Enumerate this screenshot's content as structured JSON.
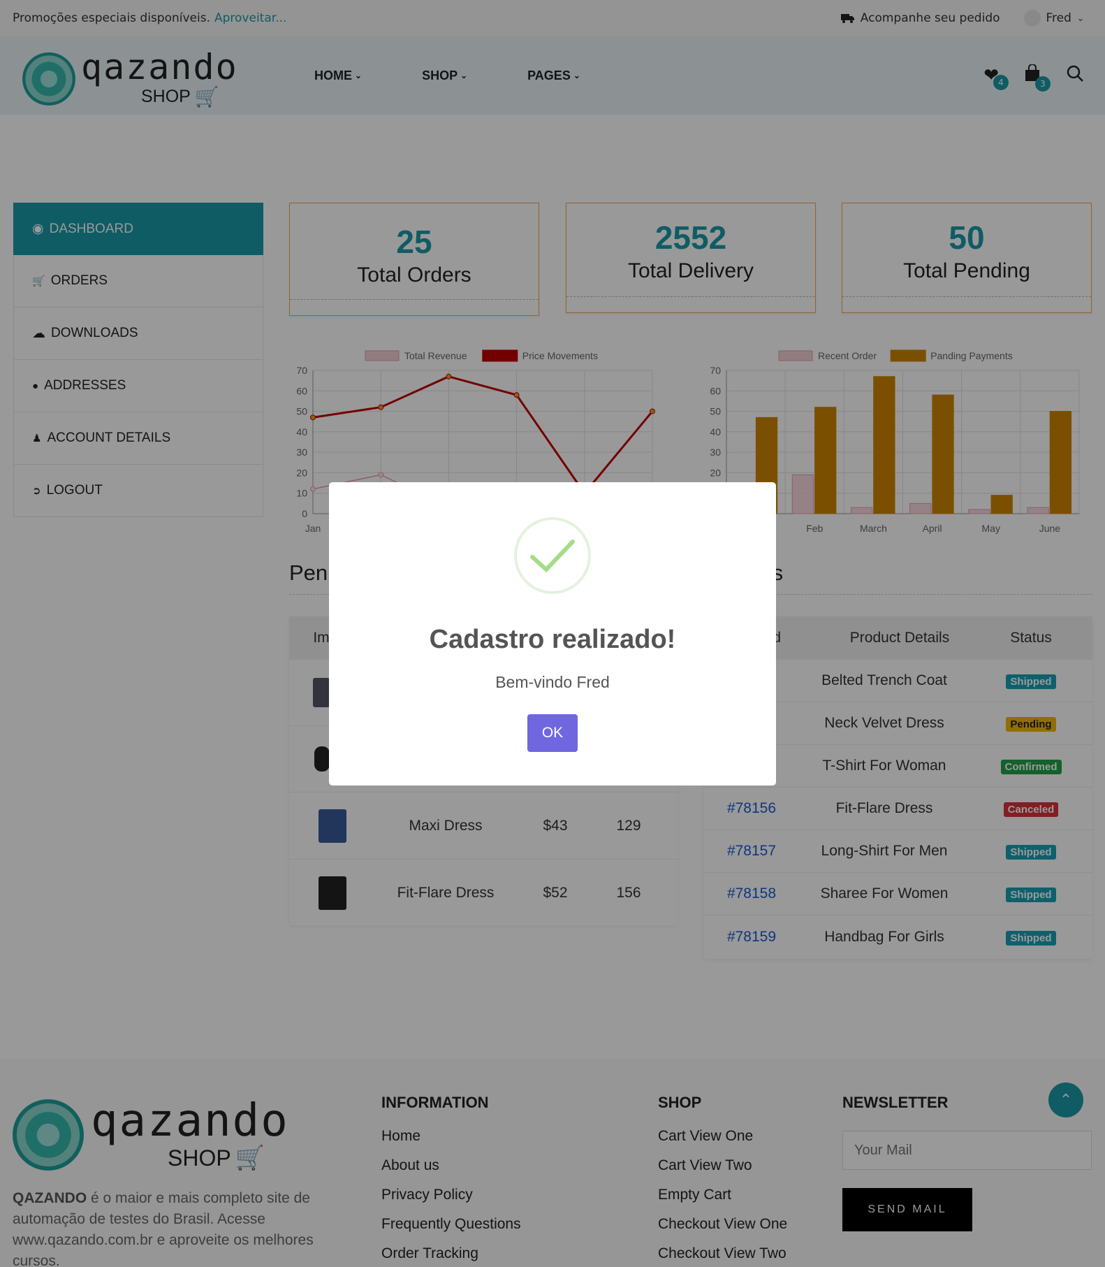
{
  "topbar": {
    "promo_text": "Promoções especiais disponíveis.",
    "promo_link": "Aproveitar...",
    "track_label": "Acompanhe seu pedido",
    "user_name": "Fred"
  },
  "header": {
    "logo_word": "qazando",
    "logo_shop": "SHOP",
    "nav": [
      {
        "label": "HOME"
      },
      {
        "label": "SHOP"
      },
      {
        "label": "PAGES"
      }
    ],
    "wishlist_count": "4",
    "cart_count": "3"
  },
  "sidebar": {
    "items": [
      {
        "label": "DASHBOARD",
        "icon": "dashboard-icon"
      },
      {
        "label": "ORDERS",
        "icon": "cart-icon"
      },
      {
        "label": "DOWNLOADS",
        "icon": "cloud-download-icon"
      },
      {
        "label": "ADDRESSES",
        "icon": "map-marker-icon"
      },
      {
        "label": "ACCOUNT DETAILS",
        "icon": "user-icon"
      },
      {
        "label": "LOGOUT",
        "icon": "logout-icon"
      }
    ]
  },
  "stats": [
    {
      "value": "25",
      "label": "Total Orders"
    },
    {
      "value": "2552",
      "label": "Total Delivery"
    },
    {
      "value": "50",
      "label": "Total Pending"
    }
  ],
  "chart_data": [
    {
      "type": "line",
      "categories": [
        "Jan",
        "Feb",
        "March",
        "April",
        "May",
        "June"
      ],
      "series": [
        {
          "name": "Total Revenue",
          "values": [
            12,
            19,
            3,
            5,
            2,
            3
          ],
          "color": "#e8a0ad"
        },
        {
          "name": "Price Movements",
          "values": [
            47,
            52,
            67,
            58,
            10,
            50
          ],
          "color": "#c00000"
        }
      ],
      "ylim": [
        0,
        70
      ],
      "yticks": [
        "70",
        "60",
        "50",
        "40",
        "30",
        "20",
        "10",
        "0"
      ],
      "grid": true,
      "legend": "top"
    },
    {
      "type": "bar",
      "categories": [
        "Jan",
        "Feb",
        "March",
        "April",
        "May",
        "June"
      ],
      "series": [
        {
          "name": "Recent Order",
          "values": [
            12,
            19,
            3,
            5,
            2,
            3
          ],
          "color": "#f6c9d2"
        },
        {
          "name": "Panding Payments",
          "values": [
            47,
            52,
            67,
            58,
            9,
            50
          ],
          "color": "#cc8500"
        }
      ],
      "ylim": [
        0,
        70
      ],
      "yticks": [
        "70",
        "60",
        "50",
        "40",
        "30",
        "20"
      ],
      "grid": true,
      "legend": "top"
    }
  ],
  "pending_section": {
    "title": "Pen",
    "head_image": "Im",
    "rows": [
      {
        "product": "Maxi Dress",
        "price": "$43",
        "qty": "129",
        "thumb": "#3a5a9a"
      },
      {
        "product": "Fit-Flare Dress",
        "price": "$52",
        "qty": "156",
        "thumb": "#222"
      }
    ]
  },
  "orders_section": {
    "title": "ers",
    "head_id": "d",
    "head_details": "Product Details",
    "head_status": "Status",
    "rows": [
      {
        "id": "",
        "product": "Belted Trench Coat",
        "status": "Shipped",
        "kind": "shipped"
      },
      {
        "id": "",
        "product": "Neck Velvet Dress",
        "status": "Pending",
        "kind": "pending"
      },
      {
        "id": "",
        "product": "T-Shirt For Woman",
        "status": "Confirmed",
        "kind": "confirmed"
      },
      {
        "id": "#78156",
        "product": "Fit-Flare Dress",
        "status": "Canceled",
        "kind": "canceled"
      },
      {
        "id": "#78157",
        "product": "Long-Shirt For Men",
        "status": "Shipped",
        "kind": "shipped"
      },
      {
        "id": "#78158",
        "product": "Sharee For Women",
        "status": "Shipped",
        "kind": "shipped"
      },
      {
        "id": "#78159",
        "product": "Handbag For Girls",
        "status": "Shipped",
        "kind": "shipped"
      }
    ]
  },
  "footer": {
    "brand": "QAZANDO",
    "desc": "é o maior e mais completo site de automação de testes do Brasil. Acesse www.qazando.com.br e aproveite os melhores cursos.",
    "info_title": "INFORMATION",
    "info_links": [
      "Home",
      "About us",
      "Privacy Policy",
      "Frequently Questions",
      "Order Tracking"
    ],
    "shop_title": "SHOP",
    "shop_links": [
      "Cart View One",
      "Cart View Two",
      "Empty Cart",
      "Checkout View One",
      "Checkout View Two"
    ],
    "news_title": "NEWSLETTER",
    "news_placeholder": "Your Mail",
    "send_label": "SEND MAIL"
  },
  "modal": {
    "title": "Cadastro realizado!",
    "message": "Bem-vindo Fred",
    "ok_label": "OK"
  }
}
